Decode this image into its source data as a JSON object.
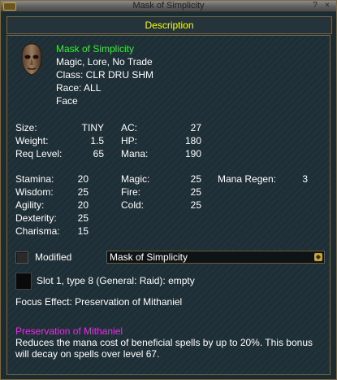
{
  "window": {
    "title": "Mask of Simplicity",
    "help": "?",
    "close": "×"
  },
  "header": {
    "label": "Description"
  },
  "item": {
    "name": "Mask of Simplicity",
    "flags": "Magic, Lore, No Trade",
    "class": "Class: CLR DRU SHM",
    "race": "Race: ALL",
    "slot": "Face",
    "icon": "face-mask-icon"
  },
  "stats": {
    "size_label": "Size:",
    "size_value": "TINY",
    "weight_label": "Weight:",
    "weight_value": "1.5",
    "reqlevel_label": "Req Level:",
    "reqlevel_value": "65",
    "ac_label": "AC:",
    "ac_value": "27",
    "hp_label": "HP:",
    "hp_value": "180",
    "mana_label": "Mana:",
    "mana_value": "190",
    "stamina_label": "Stamina:",
    "stamina_value": "20",
    "wisdom_label": "Wisdom:",
    "wisdom_value": "25",
    "agility_label": "Agility:",
    "agility_value": "20",
    "dexterity_label": "Dexterity:",
    "dexterity_value": "25",
    "charisma_label": "Charisma:",
    "charisma_value": "15",
    "magic_label": "Magic:",
    "magic_value": "25",
    "fire_label": "Fire:",
    "fire_value": "25",
    "cold_label": "Cold:",
    "cold_value": "25",
    "manaregen_label": "Mana Regen:",
    "manaregen_value": "3"
  },
  "modified": {
    "label": "Modified",
    "checked": false
  },
  "dropdown": {
    "selected": "Mask of Simplicity"
  },
  "slot_line": {
    "label": "Slot 1, type 8 (General: Raid): empty"
  },
  "focus": {
    "line": "Focus Effect: Preservation of Mithaniel",
    "name": "Preservation of Mithaniel",
    "description": "Reduces the mana cost of beneficial spells by up to 20%. This bonus will decay on spells over level 67."
  },
  "colors": {
    "name_green": "#33ee33",
    "header_yellow": "#ffff00",
    "focus_purple": "#e22ee2"
  }
}
